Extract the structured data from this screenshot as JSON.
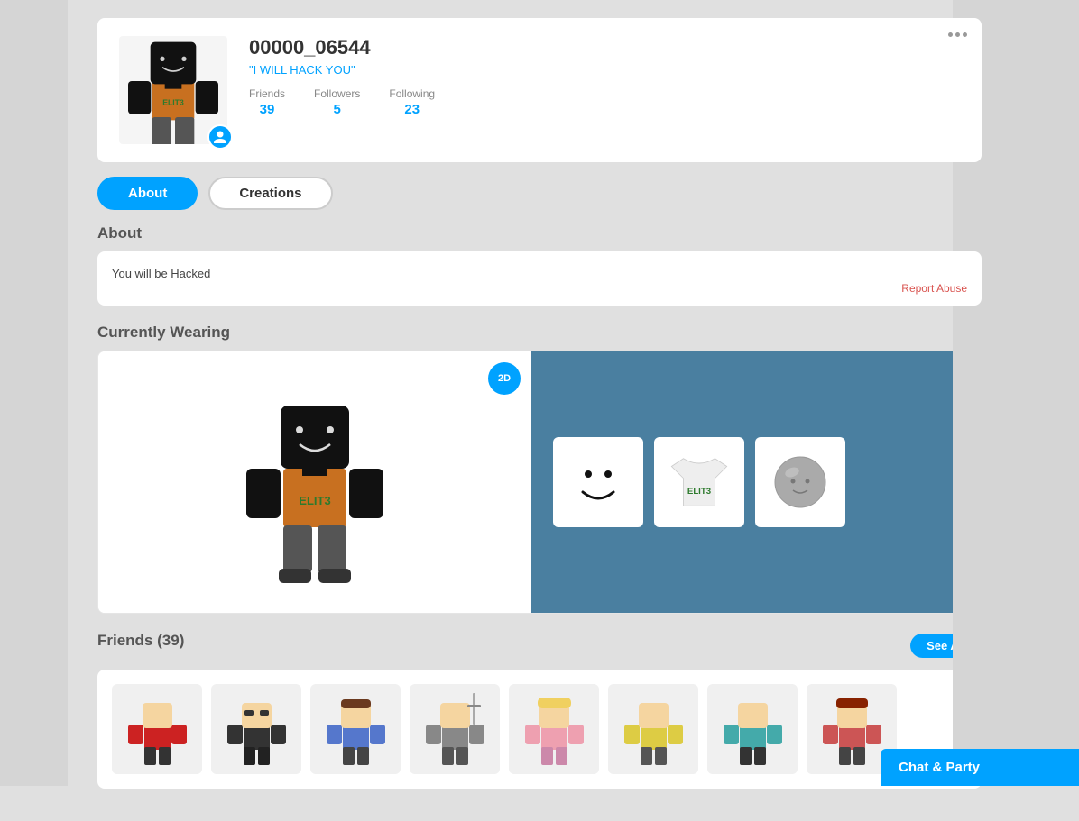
{
  "profile": {
    "username": "00000_06544",
    "status": "\"I WILL HACK YOU\"",
    "friends_label": "Friends",
    "friends_count": "39",
    "followers_label": "Followers",
    "followers_count": "5",
    "following_label": "Following",
    "following_count": "23"
  },
  "tabs": {
    "about_label": "About",
    "creations_label": "Creations"
  },
  "about": {
    "section_title": "About",
    "description": "You will be Hacked",
    "report_abuse_label": "Report Abuse"
  },
  "currently_wearing": {
    "section_title": "Currently Wearing",
    "toggle_label": "2D"
  },
  "friends": {
    "section_title": "Friends (39)",
    "see_all_label": "See All"
  },
  "chat_bar": {
    "label": "Chat & Party"
  },
  "more_options": "···"
}
